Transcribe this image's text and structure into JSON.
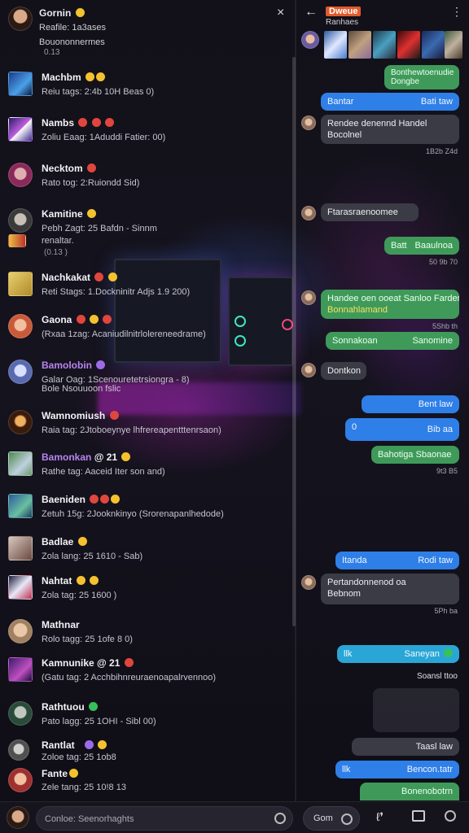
{
  "profile": {
    "name": "Gornin",
    "status": "Reafile: 1a3ases",
    "line2": "Bouononnermes",
    "meta": "0.13"
  },
  "contacts": [
    {
      "name": "Machbm",
      "preview": "Reiu tags: 2:4b 10H  Beas  0)"
    },
    {
      "name": "Nambs",
      "preview": "Zoliu Eaag: 1Aduddi  Fatier:  00)"
    },
    {
      "name": "Necktom",
      "preview": "Rato tog:  2:Ruiondd  Sid)"
    },
    {
      "name": "Kamitine",
      "preview": "Pebh Zagt:  25 Bafdn  - Sinnm",
      "extra": "renaltar.",
      "meta": "(0.13 )"
    },
    {
      "name": "Nachkakat",
      "preview": "Reti Stags:  1.Dockninitr Adjs  1.9  200)"
    },
    {
      "name": "Gaona",
      "preview": "(Rxaa 1zag:  Acaniudilnitrlolereneedrame)"
    },
    {
      "name": "Bamolobin",
      "preview": "Galar Oag: 1Scenouretetrsiongra - 8)",
      "extra": "Bole Nsouuoon fslic"
    },
    {
      "name": "Wamnomiush",
      "preview": "Raia tag:  2Jtoboeynye lhfrereapentttenrsaon)"
    },
    {
      "name": "Bamonkan",
      "preview": "Rathe tag:  Aaceid  Iter son and)"
    },
    {
      "name": "Baeniden",
      "preview": "Zetuh 15g:  2Jooknkinyo (Srorenapanlhedode)"
    },
    {
      "name": "Badlae",
      "preview": "Zola lang:  25 1610  - Sab)"
    },
    {
      "name": "Nahtat",
      "preview": "Zola tag:  25 1600 )"
    },
    {
      "name": "Mathnar",
      "preview": "Rolo tagg:  25 1ofe  8  0)"
    },
    {
      "name": "Kamnunike",
      "preview": "(Gatu tag:  2 Acchbihnreuraenoapalrvennoo)"
    },
    {
      "name": "Rathtuou",
      "preview": "Pato lagg:  25 1OHI  - Sibl  00)"
    },
    {
      "name": "Rantlat",
      "preview": "Zoloe tag:  25 1ob8"
    },
    {
      "name": "Fante",
      "preview": "Zele tang:  25 10!8  13"
    }
  ],
  "chat": {
    "title": "Dweue",
    "subtitle": "Ranhaes",
    "messages": [
      {
        "text": "Bonthewtoenudie",
        "text2": "Dongbe",
        "kind": "green"
      },
      {
        "text": "Bantar",
        "right": "Bati taw",
        "kind": "blue"
      },
      {
        "text": "Rendee denennd Handel",
        "text2": "Bocolnel",
        "kind": "gray"
      },
      {
        "text": "Ftarasraenoomee",
        "kind": "gray"
      },
      {
        "text": "Batt",
        "right": "Baaulnoa",
        "kind": "green"
      },
      {
        "text": "Handee oen ooeat Sanloo Farder",
        "text2": "Bonnahlamand",
        "kind": "green"
      },
      {
        "text": "Sonnakoan",
        "right": "Sanomine",
        "kind": "green"
      },
      {
        "text": "Dontkon",
        "kind": "gray"
      },
      {
        "text": "Bent law",
        "kind": "blue"
      },
      {
        "text": "0",
        "right": "Bib aa",
        "kind": "blue"
      },
      {
        "text": "Bahotiga Sbaonae",
        "kind": "green"
      },
      {
        "text": "Itanda",
        "right": "Rodi taw",
        "kind": "blue"
      },
      {
        "text": "Pertandonnenod oa",
        "text2": "Bebnom",
        "kind": "gray"
      },
      {
        "text": "llk",
        "right": "Saneyan",
        "kind": "cyan"
      },
      {
        "text": "Taasl law",
        "kind": "gray"
      },
      {
        "text": "llk",
        "right": "Bencon.tatr",
        "kind": "blue"
      }
    ],
    "timestamps": [
      "1B2b Z4d",
      "50 9b  70",
      "5Shb th",
      "9t3 B5",
      "5Ph ba",
      "Soansl ttoo",
      "Bonenobotrn"
    ]
  },
  "compose": {
    "placeholder": "Conloe: Seenorhaghts",
    "send_label": "Gom"
  },
  "colors": {
    "green_bubble": "#3f9a5a",
    "blue_bubble": "#2f7fe8",
    "gray_bubble": "#3b3b45",
    "title_badge": "#e25a2b",
    "purple_name": "#b884f0"
  }
}
